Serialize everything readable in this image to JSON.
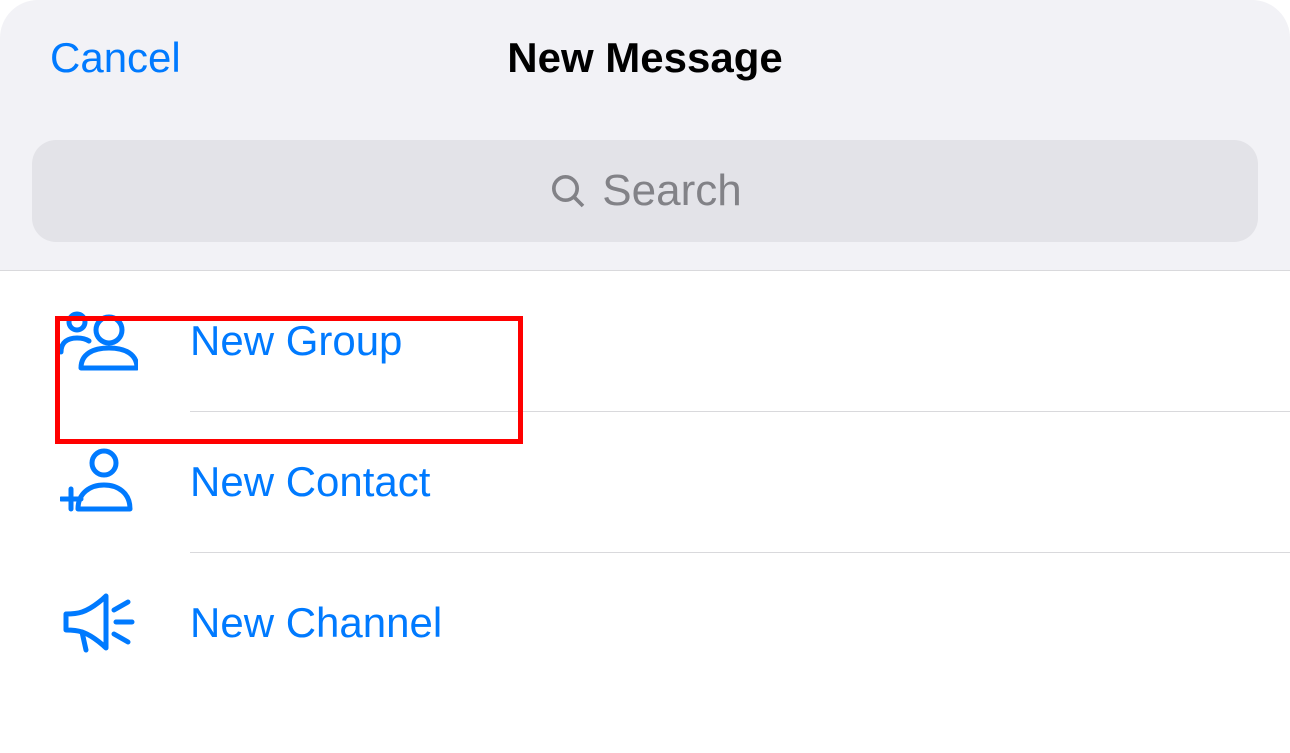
{
  "header": {
    "cancel_label": "Cancel",
    "title": "New Message"
  },
  "search": {
    "placeholder": "Search"
  },
  "actions": [
    {
      "label": "New Group"
    },
    {
      "label": "New Contact"
    },
    {
      "label": "New Channel"
    }
  ]
}
